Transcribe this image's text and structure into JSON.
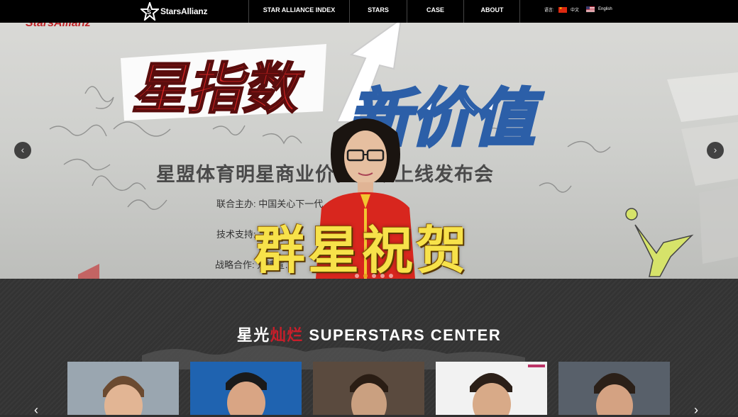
{
  "nav": {
    "logo_text": "StarsAllianz",
    "items": [
      "STAR ALLIANCE INDEX",
      "STARS",
      "CASE",
      "ABOUT"
    ],
    "language_label": "语言:",
    "languages": [
      "中文",
      "English"
    ]
  },
  "banner": {
    "brand_text": "StarsAllianz",
    "title_a": "星指数",
    "title_b": "新价值",
    "subtitle": "星盟体育明星商业价值指数上线发布会",
    "info_lines": [
      {
        "label": "联合主办:",
        "value": "中国关心下一代…我的梦基金"
      },
      {
        "label": "技术支持:",
        "value": ""
      },
      {
        "label": "战略合作:",
        "value": "万博宣…"
      }
    ],
    "congrats": "群星祝贺",
    "prev_arrow": "‹",
    "next_arrow": "›"
  },
  "superstars": {
    "title_white_1": "星光",
    "title_red": "灿烂",
    "title_white_2": " SUPERSTARS CENTER"
  },
  "colors": {
    "nav_bg": "#000000",
    "accent_red": "#c81e2a",
    "congrats_yellow": "#f7e24a",
    "section_bg": "#333333"
  }
}
